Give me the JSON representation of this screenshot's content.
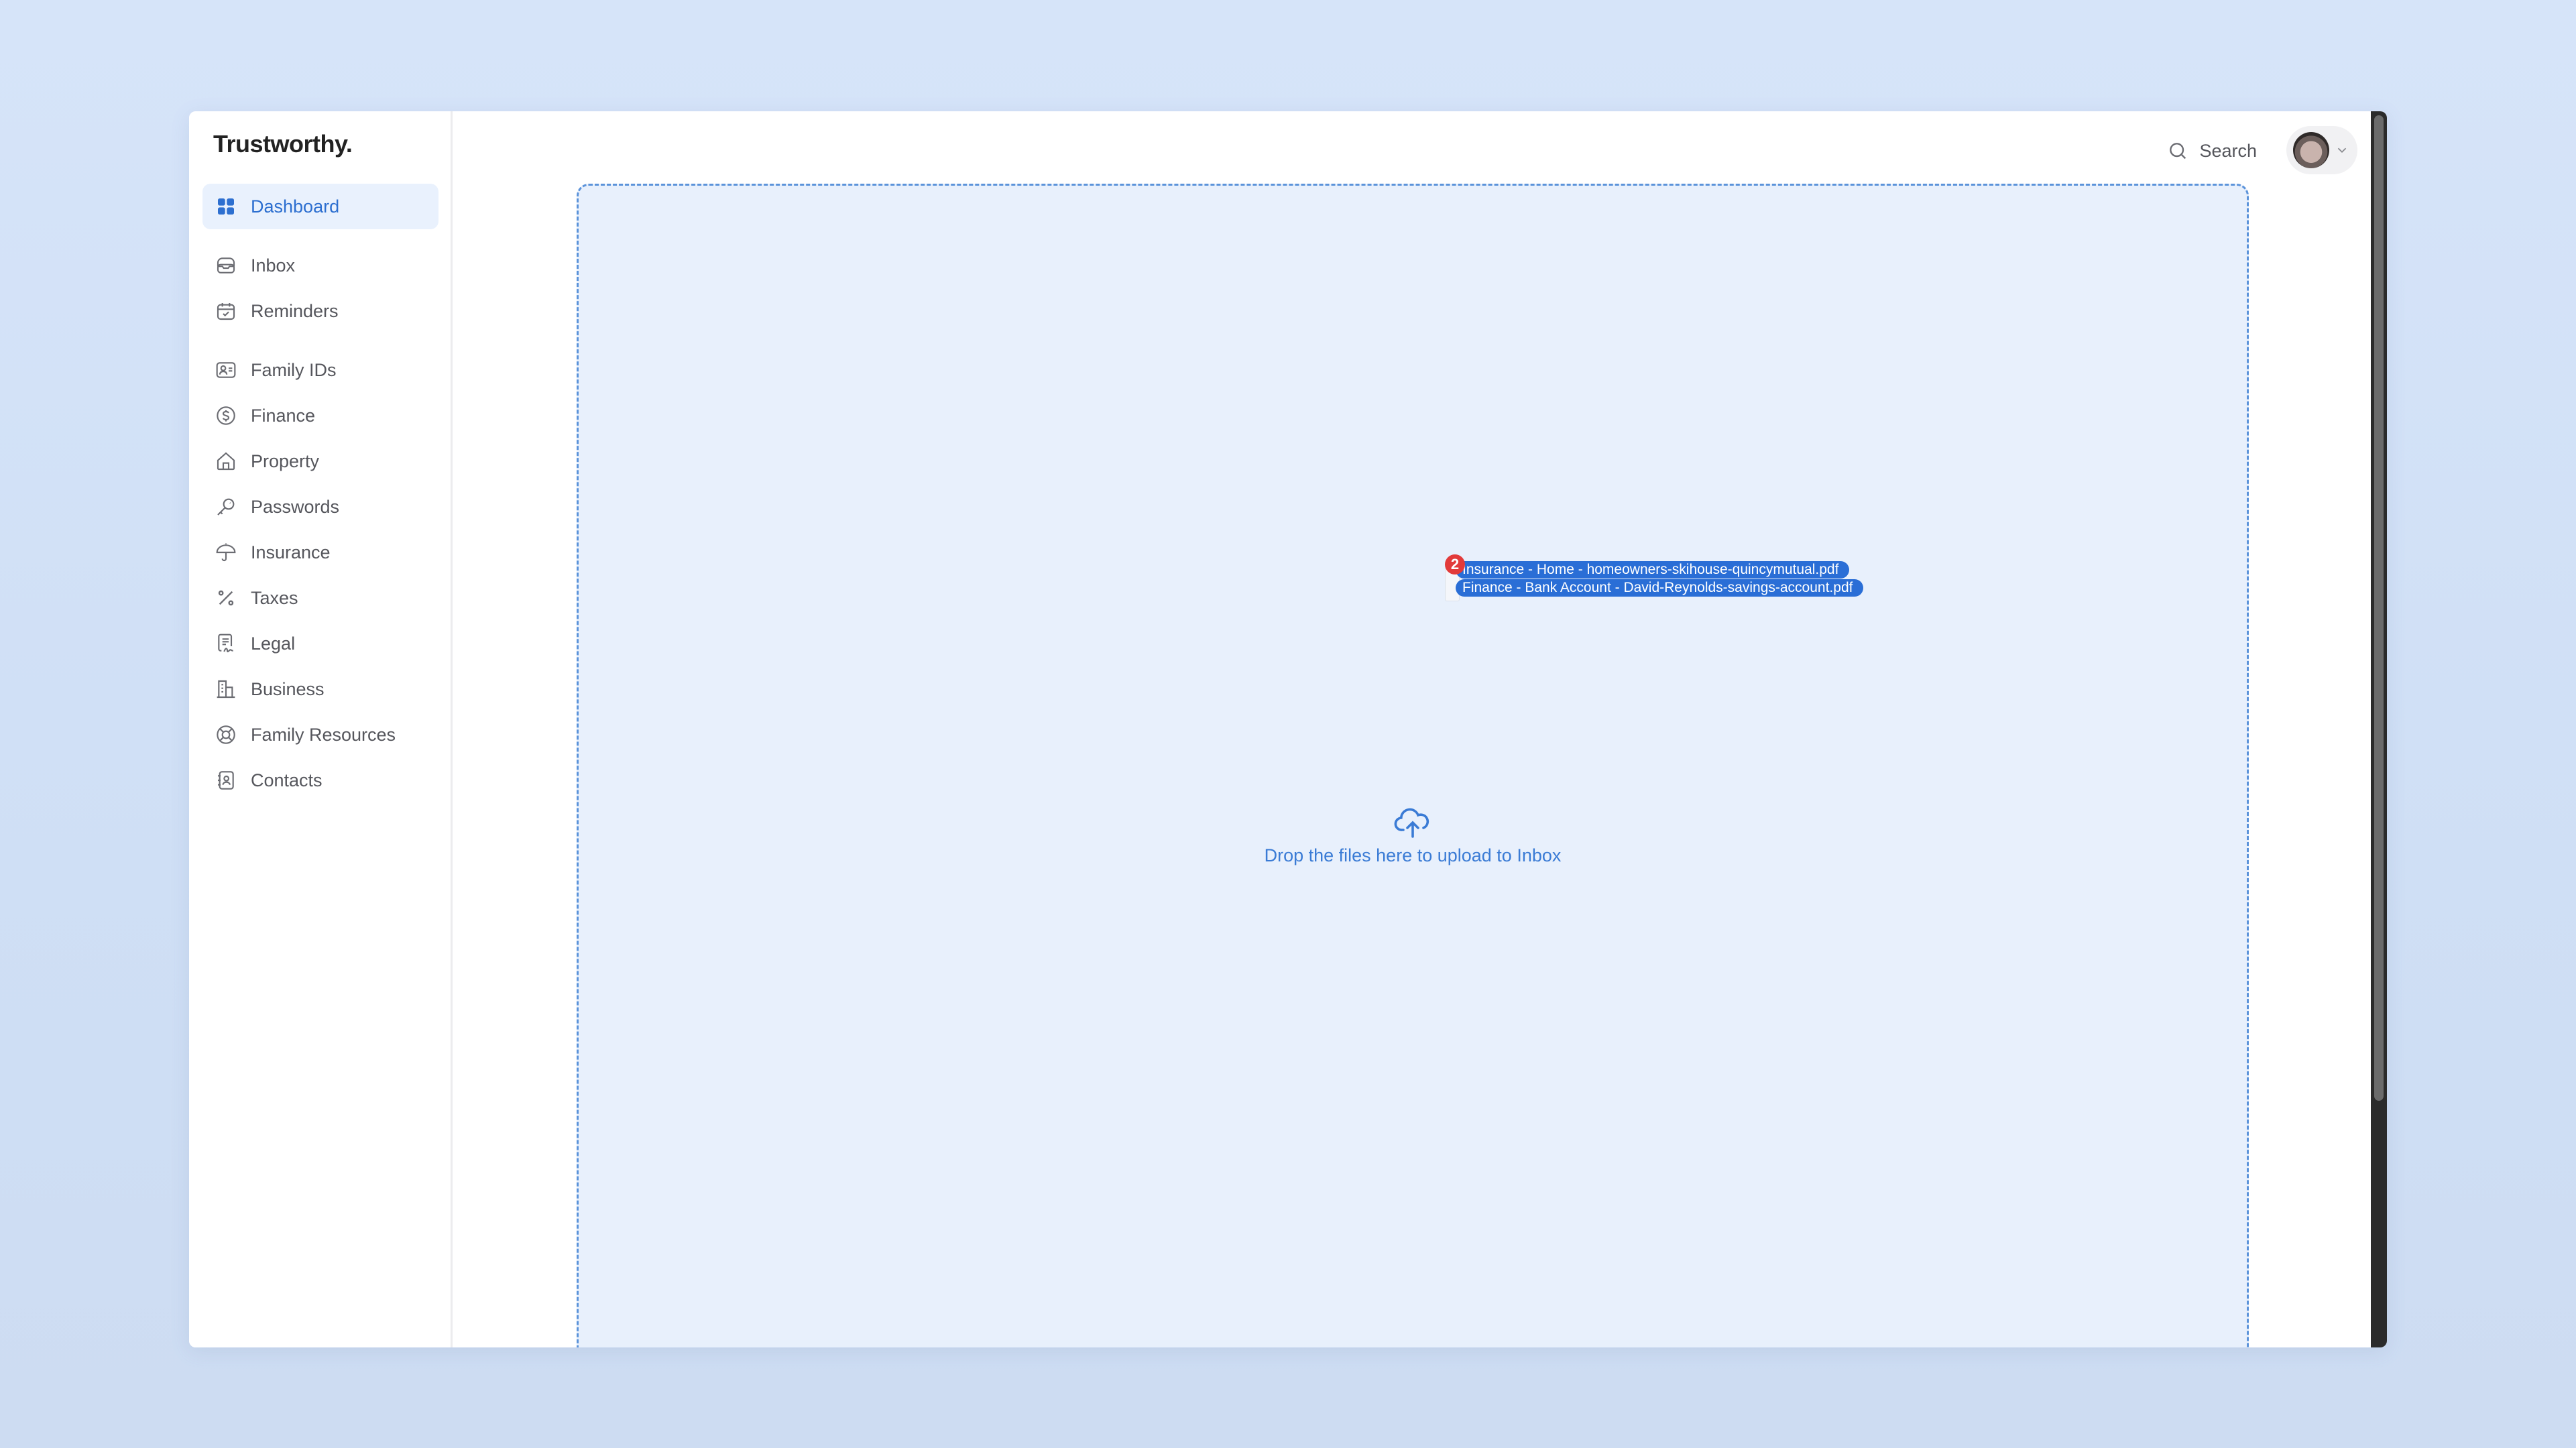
{
  "app": {
    "logo": "Trustworthy."
  },
  "sidebar": {
    "items": [
      {
        "label": "Dashboard",
        "icon": "grid-icon",
        "active": true
      },
      {
        "label": "Inbox",
        "icon": "inbox-icon"
      },
      {
        "label": "Reminders",
        "icon": "calendar-check-icon"
      },
      {
        "label": "Family IDs",
        "icon": "id-card-icon"
      },
      {
        "label": "Finance",
        "icon": "dollar-circle-icon"
      },
      {
        "label": "Property",
        "icon": "home-icon"
      },
      {
        "label": "Passwords",
        "icon": "key-icon"
      },
      {
        "label": "Insurance",
        "icon": "umbrella-icon"
      },
      {
        "label": "Taxes",
        "icon": "percent-icon"
      },
      {
        "label": "Legal",
        "icon": "contract-icon"
      },
      {
        "label": "Business",
        "icon": "building-icon"
      },
      {
        "label": "Family Resources",
        "icon": "lifebuoy-icon"
      },
      {
        "label": "Contacts",
        "icon": "address-book-icon"
      }
    ]
  },
  "header": {
    "search_label": "Search",
    "user_menu": {
      "avatar": "user-avatar",
      "chevron": "chevron-down-icon"
    }
  },
  "dropzone": {
    "message": "Drop the files here to upload to Inbox",
    "icon": "cloud-upload-icon"
  },
  "drag": {
    "count": "2",
    "files": [
      "Insurance - Home - homeowners-skihouse-quincymutual.pdf",
      "Finance - Bank Account - David-Reynolds-savings-account.pdf"
    ]
  },
  "help": {
    "icon": "help-chat-icon"
  },
  "colors": {
    "accent": "#2a6ed6",
    "dropzone_bg": "#e8f0fc",
    "badge": "#e23a3a",
    "nav_text": "#55565c"
  },
  "scrollbar": {
    "position_fraction": 0.0,
    "visible_fraction": 0.8
  }
}
